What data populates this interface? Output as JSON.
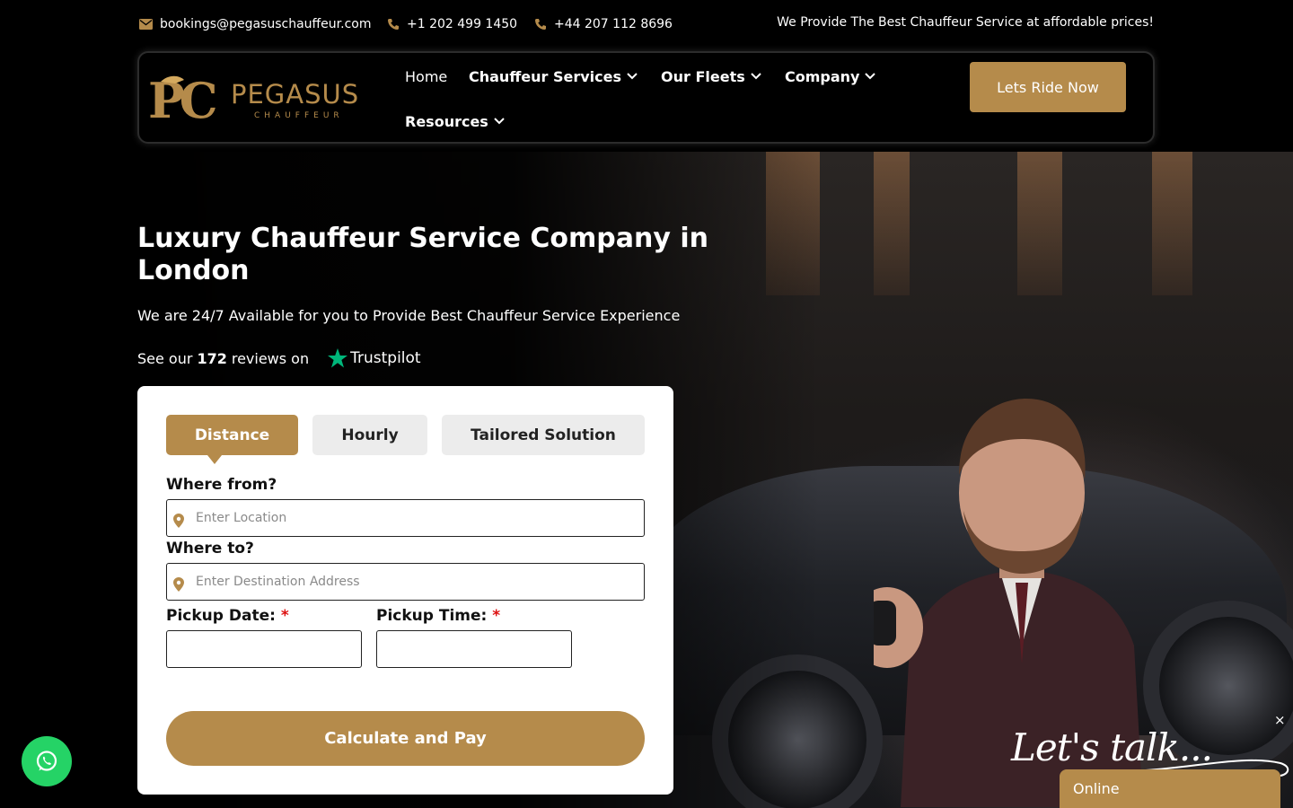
{
  "topbar": {
    "email": "bookings@pegasuschauffeur.com",
    "phone_us": "+1 202 499 1450",
    "phone_uk": "+44 207 112 8696",
    "tagline": "We Provide The Best Chauffeur Service at affordable prices!"
  },
  "brand": {
    "initials": "PC",
    "name": "PEGASUS",
    "sub": "CHAUFFEUR",
    "accent": "#b58b4b"
  },
  "nav": {
    "home": "Home",
    "chauffeur_services": "Chauffeur Services",
    "our_fleets": "Our Fleets",
    "company": "Company",
    "resources": "Resources",
    "cta": "Lets Ride Now"
  },
  "hero": {
    "title": "Luxury Chauffeur Service Company in London",
    "subtitle": "We are 24/7 Available for you to Provide Best Chauffeur Service Experience",
    "reviews_prefix": "See our",
    "reviews_count": "172",
    "reviews_suffix": "reviews on",
    "trustpilot": "Trustpilot"
  },
  "booking": {
    "tabs": [
      "Distance",
      "Hourly",
      "Tailored Solution"
    ],
    "active_tab": "Distance",
    "from_label": "Where from?",
    "from_placeholder": "Enter Location",
    "to_label": "Where to?",
    "to_placeholder": "Enter Destination Address",
    "date_label": "Pickup Date:",
    "time_label": "Pickup Time:",
    "required_mark": "*",
    "submit": "Calculate and Pay"
  },
  "chat": {
    "close": "×",
    "script": "Let's talk...",
    "status": "Online"
  },
  "widgets": {
    "whatsapp_color": "#25d366"
  }
}
